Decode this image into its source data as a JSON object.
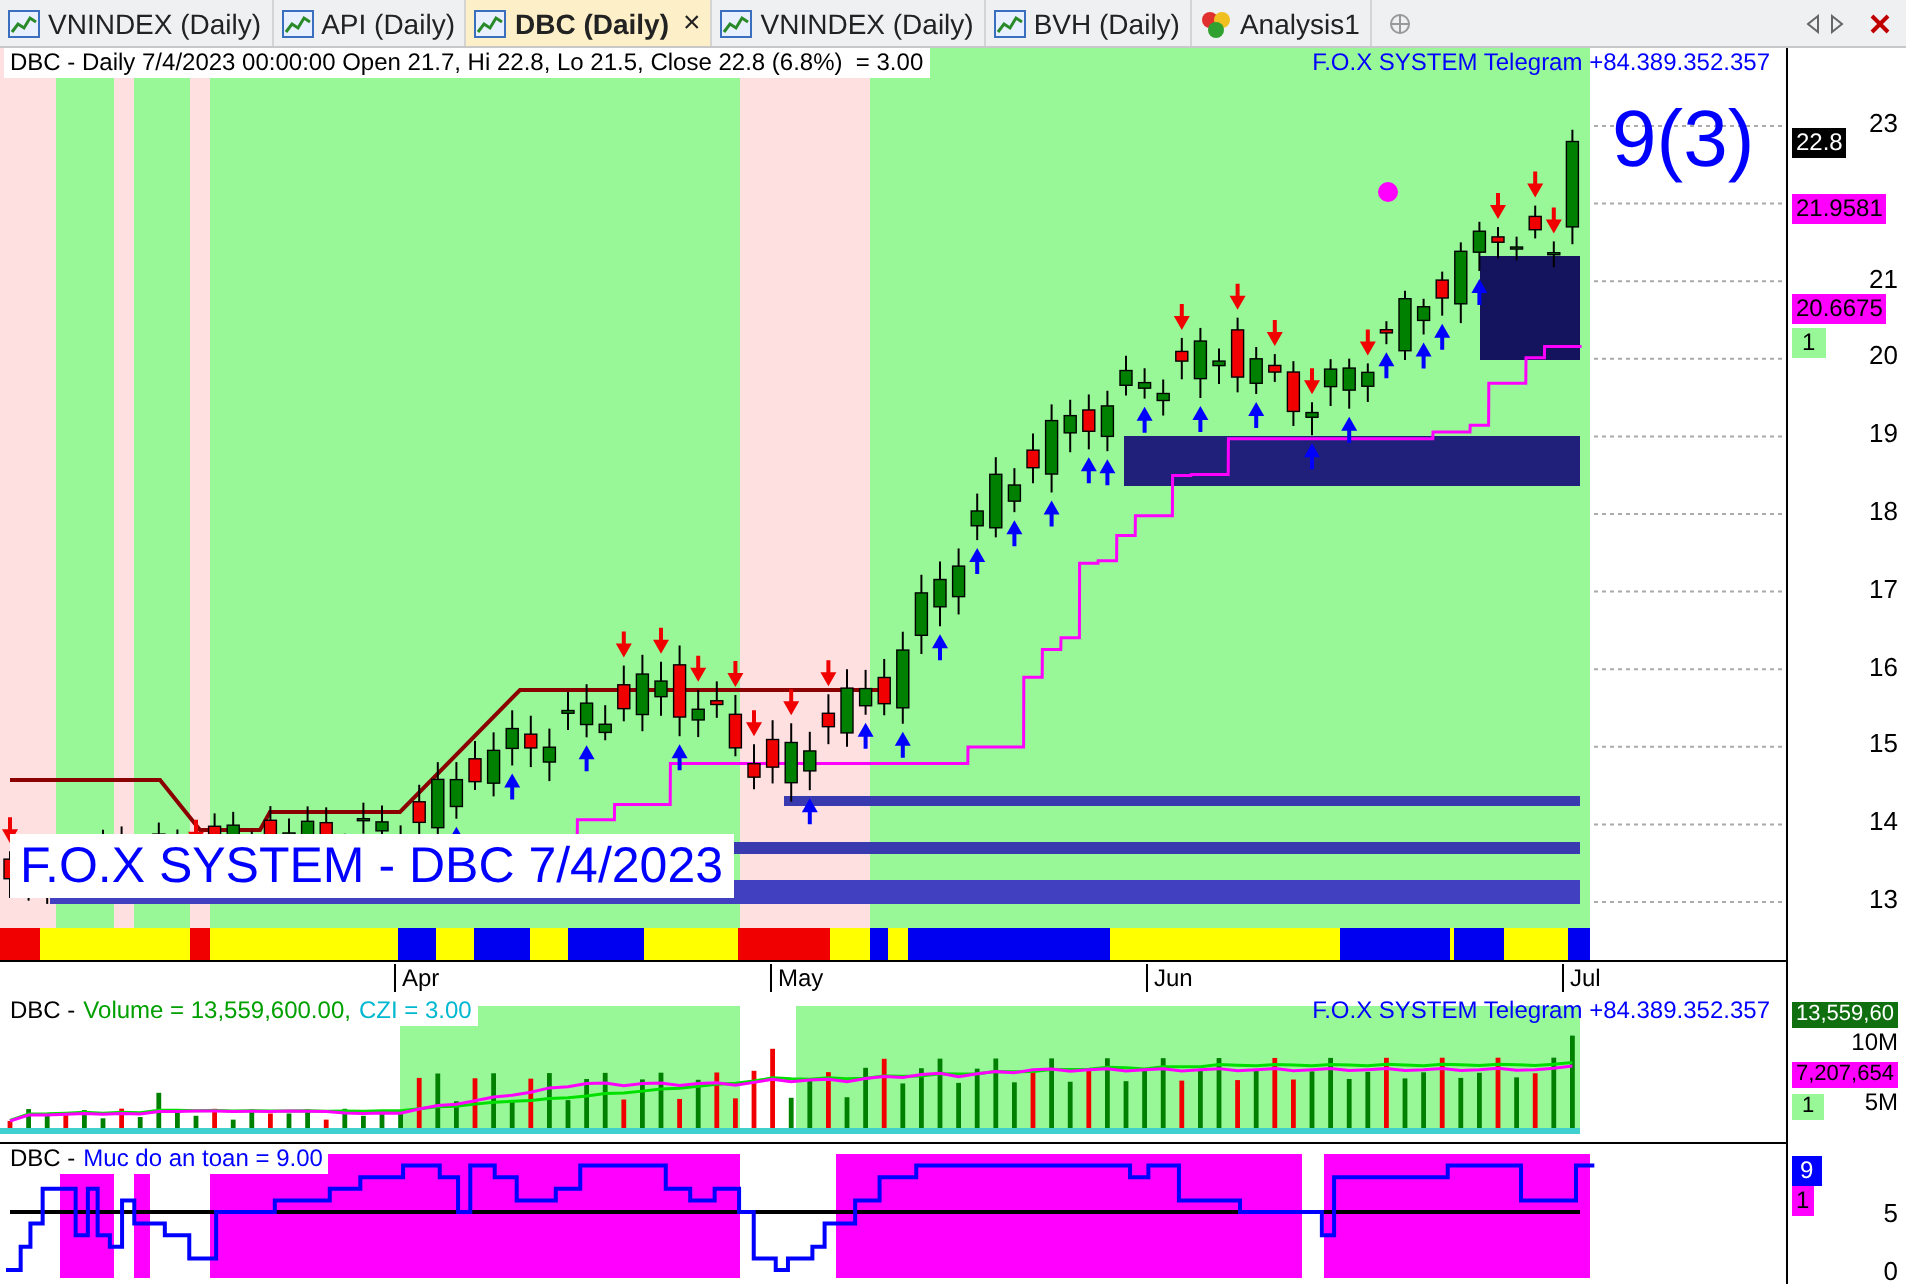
{
  "tabs": [
    {
      "label": "VNINDEX (Daily)",
      "selected": false,
      "kind": "chart"
    },
    {
      "label": "API (Daily)",
      "selected": false,
      "kind": "chart"
    },
    {
      "label": "DBC (Daily)",
      "selected": true,
      "kind": "chart",
      "close": "×"
    },
    {
      "label": "VNINDEX (Daily)",
      "selected": false,
      "kind": "chart"
    },
    {
      "label": "BVH (Daily)",
      "selected": false,
      "kind": "chart"
    },
    {
      "label": "Analysis1",
      "selected": false,
      "kind": "analysis"
    }
  ],
  "price_pane": {
    "header": "DBC - Daily 7/4/2023 00:00:00 Open 21.7, Hi 22.8, Lo 21.5, Close 22.8 (6.8%)  = 3.00",
    "telegram": "F.O.X SYSTEM Telegram +84.389.352.357",
    "signal_count": "9(3)",
    "chart_label": "F.O.X SYSTEM - DBC 7/4/2023",
    "yticks": [
      "23",
      "21",
      "20",
      "19",
      "18",
      "17",
      "16",
      "15",
      "14",
      "13"
    ],
    "badges": [
      {
        "text": "22.8",
        "kind": "last"
      },
      {
        "text": "21.9581",
        "kind": "line"
      },
      {
        "text": "20.6675",
        "kind": "line"
      },
      {
        "text": "1",
        "kind": "count"
      }
    ],
    "months": [
      "Apr",
      "May",
      "Jun",
      "Jul"
    ]
  },
  "volume_pane": {
    "header": [
      {
        "text": "DBC -",
        "color": "#000000"
      },
      {
        "text": "Volume = 13,559,600.00,",
        "color": "#00a000"
      },
      {
        "text": "CZI = 3.00",
        "color": "#00b8d0"
      }
    ],
    "telegram": "F.O.X SYSTEM Telegram +84.389.352.357",
    "yticks": [
      "10M",
      "5M"
    ],
    "badges": [
      {
        "text": "13,559,60",
        "kind": "volume"
      },
      {
        "text": "7,207,654",
        "kind": "line"
      },
      {
        "text": "1",
        "kind": "count"
      }
    ]
  },
  "safety_pane": {
    "header": [
      {
        "text": "DBC -",
        "color": "#000000"
      },
      {
        "text": "Muc do an toan = 9.00",
        "color": "#0000ff"
      }
    ],
    "yticks": [
      "5",
      "0"
    ],
    "badges": [
      {
        "text": "9",
        "kind": "safety"
      },
      {
        "text": "1",
        "kind": "magenta"
      }
    ]
  }
}
